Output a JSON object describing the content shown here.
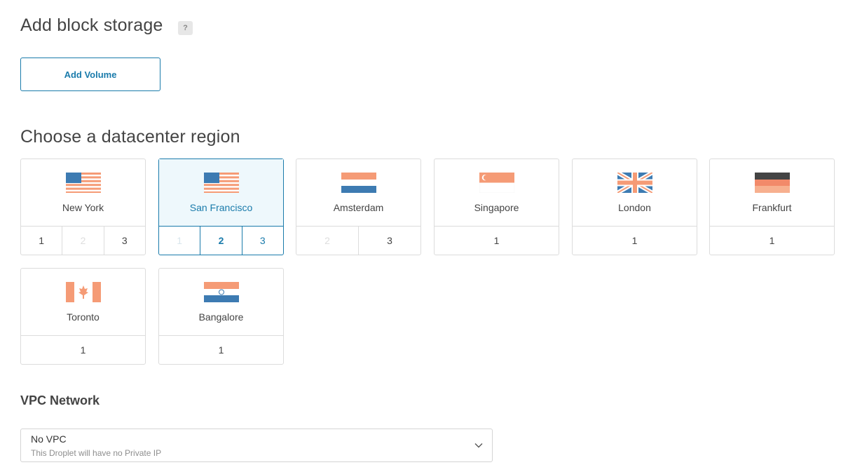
{
  "storage": {
    "title": "Add block storage",
    "help": "?",
    "add_volume_label": "Add Volume"
  },
  "region": {
    "title": "Choose a datacenter region",
    "cards": [
      {
        "name": "New York",
        "flag": "us-flag",
        "options": [
          "1",
          "2",
          "3"
        ]
      },
      {
        "name": "San Francisco",
        "flag": "us-flag",
        "options": [
          "1",
          "2",
          "3"
        ],
        "selected_option": "2"
      },
      {
        "name": "Amsterdam",
        "flag": "nl-flag",
        "options": [
          "2",
          "3"
        ]
      },
      {
        "name": "Singapore",
        "flag": "sg-flag",
        "options": [
          "1"
        ]
      },
      {
        "name": "London",
        "flag": "uk-flag",
        "options": [
          "1"
        ]
      },
      {
        "name": "Frankfurt",
        "flag": "de-flag",
        "options": [
          "1"
        ]
      },
      {
        "name": "Toronto",
        "flag": "ca-flag",
        "options": [
          "1"
        ]
      },
      {
        "name": "Bangalore",
        "flag": "in-flag",
        "options": [
          "1"
        ]
      }
    ]
  },
  "vpc": {
    "title": "VPC Network",
    "selected_label": "No VPC",
    "selected_description": "This Droplet will have no Private IP"
  },
  "colors": {
    "accent": "#1a7bab",
    "flag_orange": "#f59b76",
    "flag_blue": "#3d7bb2",
    "flag_dark": "#444444"
  }
}
